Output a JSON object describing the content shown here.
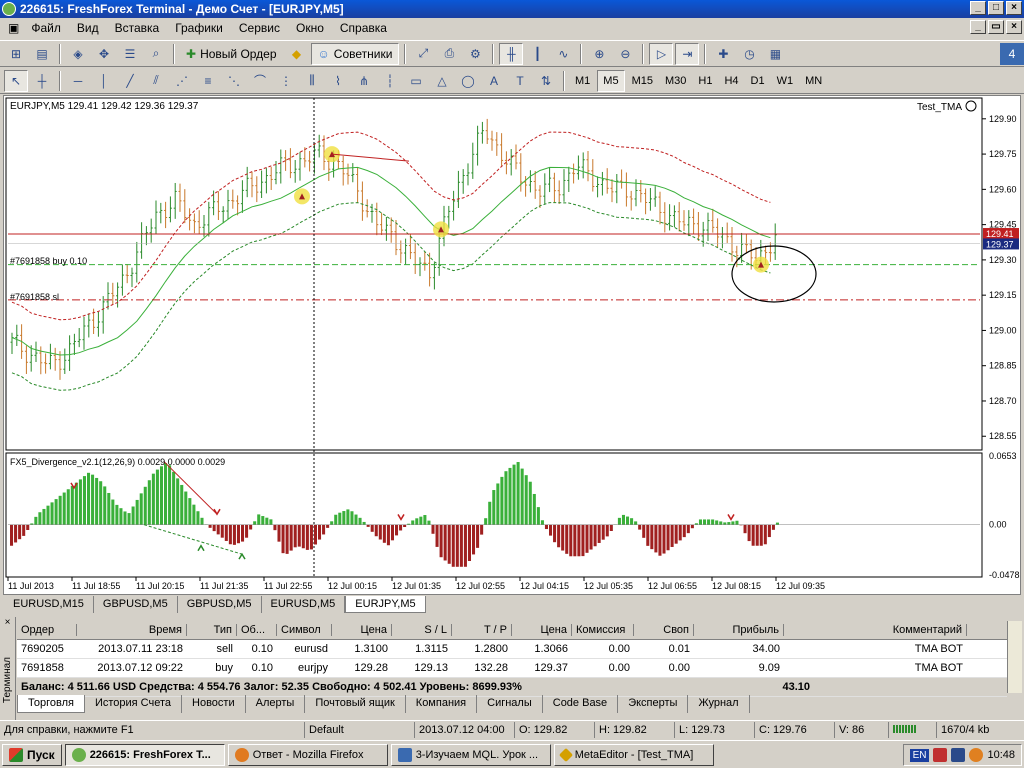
{
  "window": {
    "title": "226615: FreshForex Terminal - Демо Счет - [EURJPY,M5]"
  },
  "menu": [
    "Файл",
    "Вид",
    "Вставка",
    "Графики",
    "Сервис",
    "Окно",
    "Справка"
  ],
  "toolbar": {
    "new_order": "Новый Ордер",
    "experts": "Советники"
  },
  "timeframes": [
    "M1",
    "M5",
    "M15",
    "M30",
    "H1",
    "H4",
    "D1",
    "W1",
    "MN"
  ],
  "active_timeframe": "M5",
  "chart": {
    "symbol_header": "EURJPY,M5  129.41 129.42 129.36 129.37",
    "expert_name": "Test_TMA",
    "order_buy_label": "#7691858 buy 0.10",
    "order_sl_label": "#7691858 sl",
    "bid_price": "129.41",
    "ask_price": "129.37",
    "indicator_header": "FX5_Divergence_v2.1(12,26,9) 0.0029 0.0000 0.0029"
  },
  "chart_data": [
    {
      "type": "candlestick",
      "title": "EURJPY,M5",
      "ylim": [
        128.5,
        129.98
      ],
      "yticks": [
        "129.90",
        "129.75",
        "129.60",
        "129.45",
        "129.30",
        "129.15",
        "129.00",
        "128.85",
        "128.70",
        "128.55"
      ],
      "xticks": [
        "11 Jul 2013",
        "11 Jul 18:55",
        "11 Jul 20:15",
        "11 Jul 21:35",
        "11 Jul 22:55",
        "12 Jul 00:15",
        "12 Jul 01:35",
        "12 Jul 02:55",
        "12 Jul 04:15",
        "12 Jul 05:35",
        "12 Jul 06:55",
        "12 Jul 08:15",
        "12 Jul 09:35"
      ],
      "close_approx": [
        128.95,
        128.9,
        128.85,
        128.9,
        129.0,
        129.1,
        129.2,
        129.35,
        129.5,
        129.55,
        129.45,
        129.5,
        129.55,
        129.6,
        129.65,
        129.7,
        129.72,
        129.75,
        129.7,
        129.6,
        129.45,
        129.4,
        129.3,
        129.25,
        129.5,
        129.7,
        129.85,
        129.75,
        129.65,
        129.6,
        129.6,
        129.7,
        129.65,
        129.6,
        129.6,
        129.55,
        129.5,
        129.45,
        129.45,
        129.4,
        129.35,
        129.3,
        129.4
      ],
      "lines": {
        "bid": 129.41,
        "ask": 129.37,
        "buy_order": 129.28,
        "stop_loss": 129.13
      }
    },
    {
      "type": "bar",
      "title": "FX5_Divergence_v2.1(12,26,9)",
      "ylim": [
        -0.0478,
        0.0653
      ],
      "yticks": [
        "0.0653",
        "0.00",
        "-0.0478"
      ],
      "values_approx": [
        -0.02,
        -0.01,
        0.01,
        0.02,
        0.03,
        0.04,
        0.05,
        0.04,
        0.02,
        0.01,
        0.03,
        0.05,
        0.06,
        0.04,
        0.02,
        0.0,
        -0.01,
        -0.02,
        -0.015,
        0.01,
        0.005,
        -0.03,
        -0.02,
        -0.025,
        -0.01,
        0.01,
        0.015,
        0.005,
        -0.01,
        -0.02,
        -0.005,
        0.005,
        0.01,
        -0.03,
        -0.04,
        -0.04,
        -0.02,
        0.03,
        0.05,
        0.06,
        0.04,
        0.0,
        -0.02,
        -0.03,
        -0.03,
        -0.02,
        -0.01,
        0.01,
        0.005,
        -0.02,
        -0.03,
        -0.02,
        -0.01,
        0.005,
        0.005,
        0.002,
        0.004,
        -0.02,
        -0.02,
        0.002
      ]
    }
  ],
  "symbol_tabs": [
    "EURUSD,M15",
    "GBPUSD,M5",
    "GBPUSD,M5",
    "EURUSD,M5",
    "EURJPY,M5"
  ],
  "terminal": {
    "side_label": "Терминал",
    "columns": [
      "Ордер",
      "Время",
      "Тип",
      "Об...",
      "Символ",
      "Цена",
      "S / L",
      "T / P",
      "Цена",
      "Комиссия",
      "Своп",
      "Прибыль",
      "Комментарий"
    ],
    "rows": [
      [
        "7690205",
        "2013.07.11 23:18",
        "sell",
        "0.10",
        "eurusd",
        "1.3100",
        "1.3115",
        "1.2800",
        "1.3066",
        "0.00",
        "0.01",
        "34.00",
        "TMA BOT"
      ],
      [
        "7691858",
        "2013.07.12 09:22",
        "buy",
        "0.10",
        "eurjpy",
        "129.28",
        "129.13",
        "132.28",
        "129.37",
        "0.00",
        "0.00",
        "9.09",
        "TMA BOT"
      ]
    ],
    "balance": "Баланс: 4 511.66 USD  Средства: 4 554.76  Залог: 52.35  Свободно: 4 502.41  Уровень: 8699.93%",
    "balance_profit": "43.10",
    "tabs": [
      "Торговля",
      "История Счета",
      "Новости",
      "Алерты",
      "Почтовый ящик",
      "Компания",
      "Сигналы",
      "Code Base",
      "Эксперты",
      "Журнал"
    ]
  },
  "status": {
    "help": "Для справки, нажмите F1",
    "profile": "Default",
    "datetime": "2013.07.12 04:00",
    "open": "O: 129.82",
    "high": "H: 129.82",
    "low": "L: 129.73",
    "close": "C: 129.76",
    "volume": "V: 86",
    "traffic": "1670/4 kb"
  },
  "taskbar": {
    "start": "Пуск",
    "items": [
      "226615: FreshForex T...",
      "Ответ - Mozilla Firefox",
      "3-Изучаем MQL. Урок ...",
      "MetaEditor - [Test_TMA]"
    ],
    "lang": "EN",
    "clock": "10:48"
  }
}
